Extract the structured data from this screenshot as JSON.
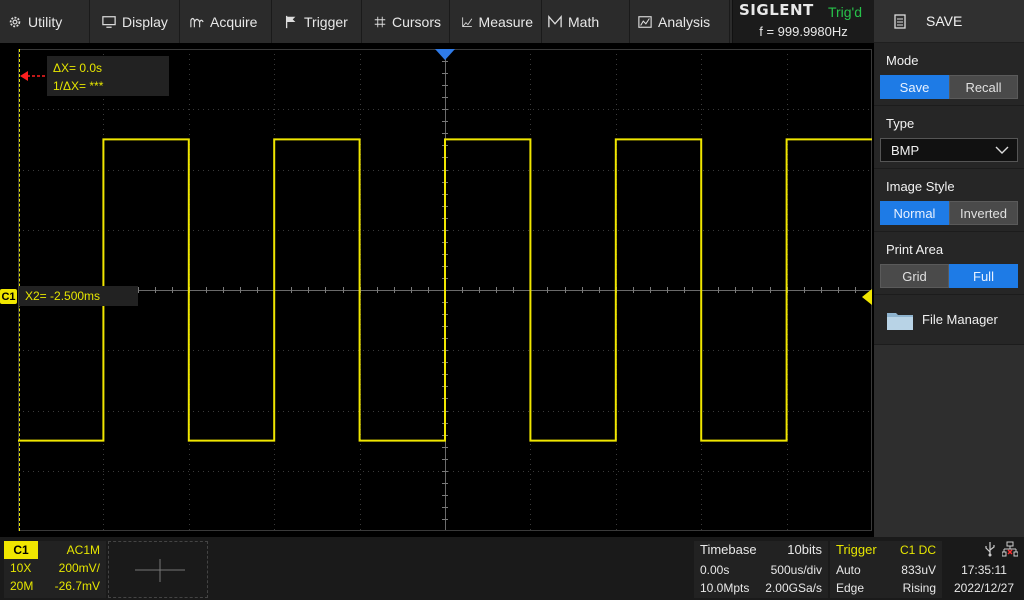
{
  "menu": {
    "items": [
      {
        "label": "Utility",
        "icon": "gear-icon"
      },
      {
        "label": "Display",
        "icon": "monitor-icon"
      },
      {
        "label": "Acquire",
        "icon": "acquire-icon"
      },
      {
        "label": "Trigger",
        "icon": "flag-icon"
      },
      {
        "label": "Cursors",
        "icon": "crosshair-icon"
      },
      {
        "label": "Measure",
        "icon": "measure-icon"
      },
      {
        "label": "Math",
        "icon": "math-icon"
      },
      {
        "label": "Analysis",
        "icon": "analysis-icon"
      }
    ]
  },
  "brand": {
    "logo": "SIGLENT",
    "trigger_status": "Trig'd",
    "frequency": "f = 999.9980Hz"
  },
  "panel": {
    "title": "SAVE",
    "mode": {
      "label": "Mode",
      "options": [
        "Save",
        "Recall"
      ],
      "selected": "Save"
    },
    "type": {
      "label": "Type",
      "value": "BMP"
    },
    "image_style": {
      "label": "Image Style",
      "options": [
        "Normal",
        "Inverted"
      ],
      "selected": "Normal"
    },
    "print_area": {
      "label": "Print Area",
      "options": [
        "Grid",
        "Full"
      ],
      "selected": "Full"
    },
    "file_manager": "File Manager"
  },
  "cursors": {
    "delta_x": "ΔX= 0.0s",
    "inv_delta_x": "1/ΔX= ***",
    "x2": "X2= -2.500ms"
  },
  "channel_marker": "C1",
  "status": {
    "channel": {
      "name": "C1",
      "coupling": "AC1M",
      "probe": "10X",
      "volts_div": "200mV/",
      "bandwidth": "20M",
      "offset": "-26.7mV"
    },
    "timebase": {
      "label": "Timebase",
      "bits": "10bits",
      "delay": "0.00s",
      "time_div": "500us/div",
      "memory": "10.0Mpts",
      "sample_rate": "2.00GSa/s"
    },
    "trigger": {
      "label": "Trigger",
      "source": "C1 DC",
      "mode": "Auto",
      "level": "833uV",
      "type": "Edge",
      "slope": "Rising"
    },
    "clock": {
      "time": "17:35:11",
      "date": "2022/12/27"
    }
  },
  "colors": {
    "channel1": "#f0e600",
    "accent": "#1e7be6",
    "trig_status": "#27c24a",
    "cursor": "#ff2020",
    "trigger_marker": "#2f7be8"
  }
}
